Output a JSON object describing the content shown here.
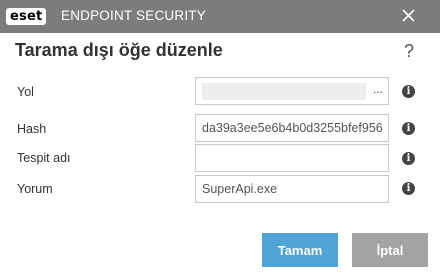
{
  "titlebar": {
    "logo_text": "eset",
    "product_name": "ENDPOINT SECURITY",
    "background": "#7c7c7c"
  },
  "dialog": {
    "title": "Tarama dışı öğe düzenle",
    "help_symbol": "?"
  },
  "fields": {
    "path": {
      "label": "Yol",
      "value": "",
      "browse": "..."
    },
    "hash": {
      "label": "Hash",
      "value": "da39a3ee5e6b4b0d3255bfef956"
    },
    "detection": {
      "label": "Tespit adı",
      "value": ""
    },
    "comment": {
      "label": "Yorum",
      "value": "SuperApi.exe"
    }
  },
  "info_symbol": "i",
  "buttons": {
    "ok": "Tamam",
    "cancel": "İptal"
  },
  "colors": {
    "primary": "#4fa3d6",
    "secondary": "#a3a3a3"
  }
}
